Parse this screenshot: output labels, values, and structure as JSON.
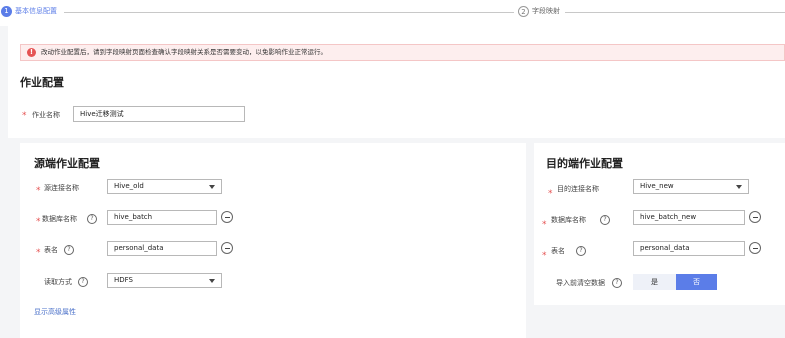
{
  "stepper": {
    "step1_num": "1",
    "step1_label": "基本信息配置",
    "step2_num": "2",
    "step2_label": "字段映射"
  },
  "alert": {
    "icon": "!",
    "text": "改动作业配置后，请到字段映射页面检查确认字段映射关系是否需要变动，以免影响作业正常运行。"
  },
  "job_config": {
    "title": "作业配置",
    "name_label": "作业名称",
    "name_value": "Hive迁移测试"
  },
  "source": {
    "title": "源端作业配置",
    "connection_label": "源连接名称",
    "connection_value": "Hive_old",
    "database_label": "数据库名称",
    "database_value": "hive_batch",
    "table_label": "表名",
    "table_value": "personal_data",
    "read_mode_label": "读取方式",
    "read_mode_value": "HDFS",
    "advanced_link": "显示高级属性"
  },
  "target": {
    "title": "目的端作业配置",
    "connection_label": "目的连接名称",
    "connection_value": "Hive_new",
    "database_label": "数据库名称",
    "database_value": "hive_batch_new",
    "table_label": "表名",
    "table_value": "personal_data",
    "clear_label": "导入前清空数据",
    "clear_yes": "是",
    "clear_no": "否",
    "clear_selected": "否"
  },
  "common": {
    "required_mark": "*",
    "help_mark": "?"
  },
  "colors": {
    "accent": "#5b7de8",
    "alert_bg": "#fdeeee",
    "alert_icon": "#e55353",
    "required": "#e55353",
    "link": "#4a70c9"
  }
}
